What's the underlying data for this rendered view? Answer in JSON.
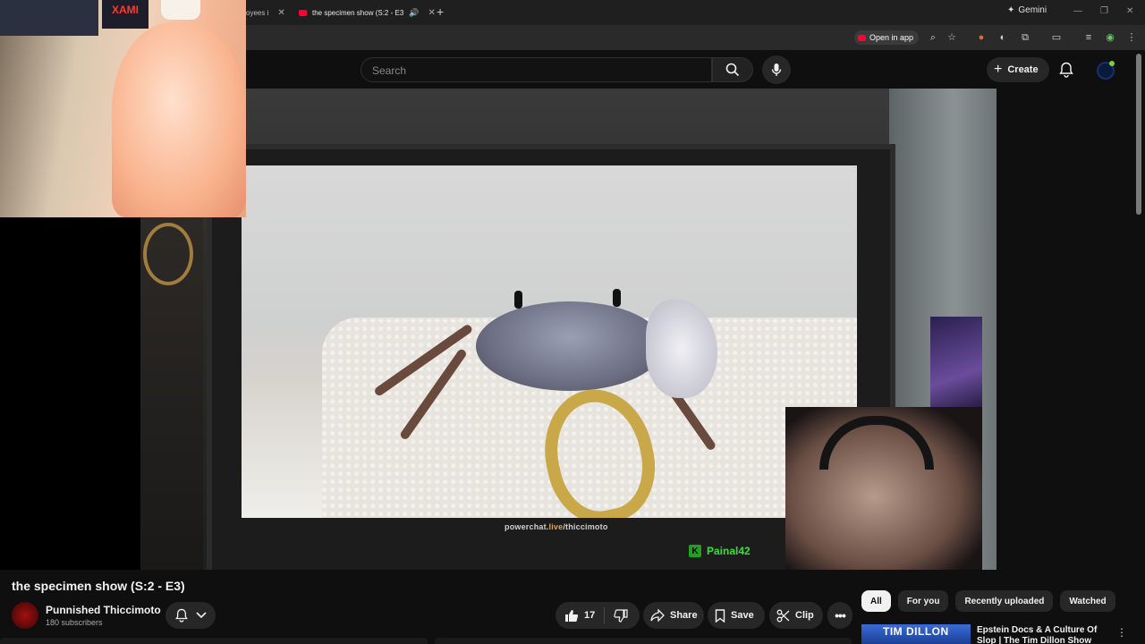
{
  "browser": {
    "tabs": [
      {
        "label": "oyees i",
        "active": false
      },
      {
        "label": "the specimen show (S:2 - E3",
        "active": true
      }
    ],
    "gemini_label": "Gemini",
    "open_in_app_label": "Open in app"
  },
  "youtube": {
    "search_placeholder": "Search",
    "create_label": "Create"
  },
  "player": {
    "watermark_prefix": "powerchat.",
    "watermark_live": "live",
    "watermark_suffix": "/thiccimoto",
    "chat_badge": "K",
    "chat_username": "Painal42",
    "overlay_sign": "XAMI"
  },
  "video": {
    "title": "the specimen show (S:2 - E3)",
    "channel_name": "Punnished Thiccimoto",
    "subscribers": "180 subscribers",
    "like_count": "17",
    "share_label": "Share",
    "save_label": "Save",
    "clip_label": "Clip"
  },
  "chips": [
    {
      "label": "All",
      "active": true
    },
    {
      "label": "For you",
      "active": false
    },
    {
      "label": "Recently uploaded",
      "active": false
    },
    {
      "label": "Watched",
      "active": false
    }
  ],
  "recommendation": {
    "thumb_text": "TIM DILLON",
    "title": "Epstein Docs & A Culture Of Slop | The Tim Dillon Show"
  },
  "colors": {
    "youtube_red": "#ff0033",
    "background": "#0f0f0f",
    "chat_green": "#35e035"
  }
}
